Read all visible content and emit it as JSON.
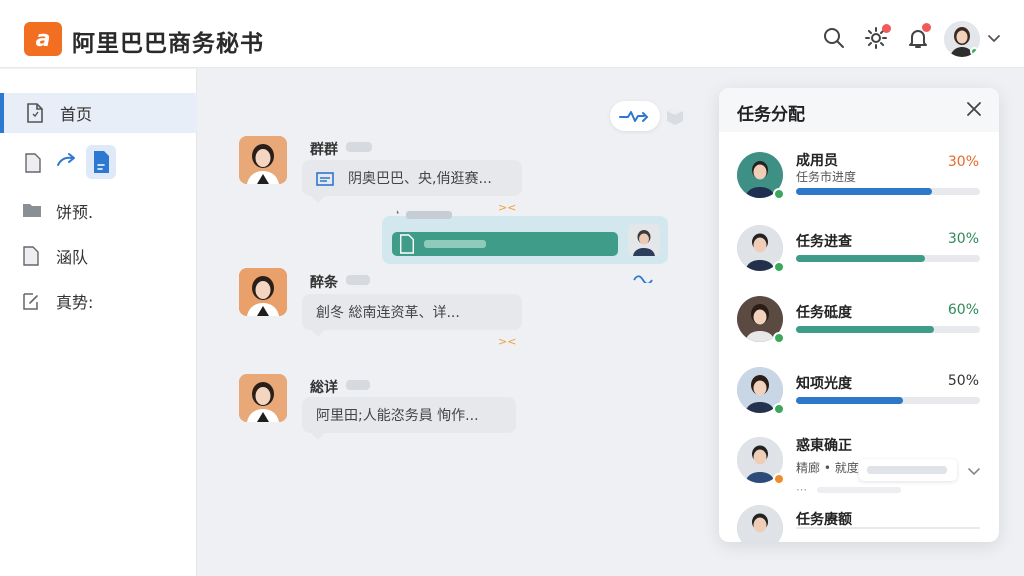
{
  "app": {
    "title": "阿里巴巴商务秘书",
    "logo_text": "a"
  },
  "header": {
    "icons": [
      "search-icon",
      "gear-icon",
      "bell-icon"
    ],
    "has_notification": true
  },
  "sidebar": {
    "items": [
      {
        "label": "首页",
        "icon": "document-icon",
        "active": true
      },
      {
        "label": "",
        "icon": "file-icon",
        "active": false
      },
      {
        "label": "饼预.",
        "icon": "folder-icon",
        "active": false
      },
      {
        "label": "涵队",
        "icon": "file-icon",
        "active": false
      },
      {
        "label": "真势:",
        "icon": "edit-icon",
        "active": false
      }
    ]
  },
  "chat": {
    "messages": [
      {
        "name": "群群",
        "text": "阴奥巴巴、央,俏逛赛...",
        "side": "left"
      },
      {
        "name": "",
        "text": "",
        "side": "right"
      },
      {
        "name": "醉条",
        "text": "創冬 総南连资革、详...",
        "side": "left"
      },
      {
        "name": "総详",
        "text": "阿里田;人能恣务員 恂作...",
        "side": "left"
      }
    ]
  },
  "panel": {
    "title": "任务分配",
    "tasks": [
      {
        "name": "成用员",
        "sub": "任务市进度",
        "percent": "30%",
        "progress": 0.74,
        "bar_color": "#2d78c8",
        "pct_color": "#e8682a",
        "status_color": "#3aa85a"
      },
      {
        "name": "任务进查",
        "sub": "",
        "percent": "30%",
        "progress": 0.7,
        "bar_color": "#3e9c88",
        "pct_color": "#2f8a57",
        "status_color": "#3aa85a"
      },
      {
        "name": "任务砥度",
        "sub": "",
        "percent": "60%",
        "progress": 0.75,
        "bar_color": "#3e9c88",
        "pct_color": "#2f8a57",
        "status_color": "#3aa85a"
      },
      {
        "name": "知项光度",
        "sub": "",
        "percent": "50%",
        "progress": 0.58,
        "bar_color": "#2d78c8",
        "pct_color": "#333333",
        "status_color": "#3aa85a"
      },
      {
        "name": "惑東确正",
        "sub": "精廊 • 就度",
        "percent": "",
        "progress": null,
        "bar_color": "",
        "pct_color": "",
        "status_color": "#f08a2a"
      },
      {
        "name": "任务赓额",
        "sub": "",
        "percent": "",
        "progress": null,
        "bar_color": "",
        "pct_color": "",
        "status_color": ""
      }
    ]
  }
}
